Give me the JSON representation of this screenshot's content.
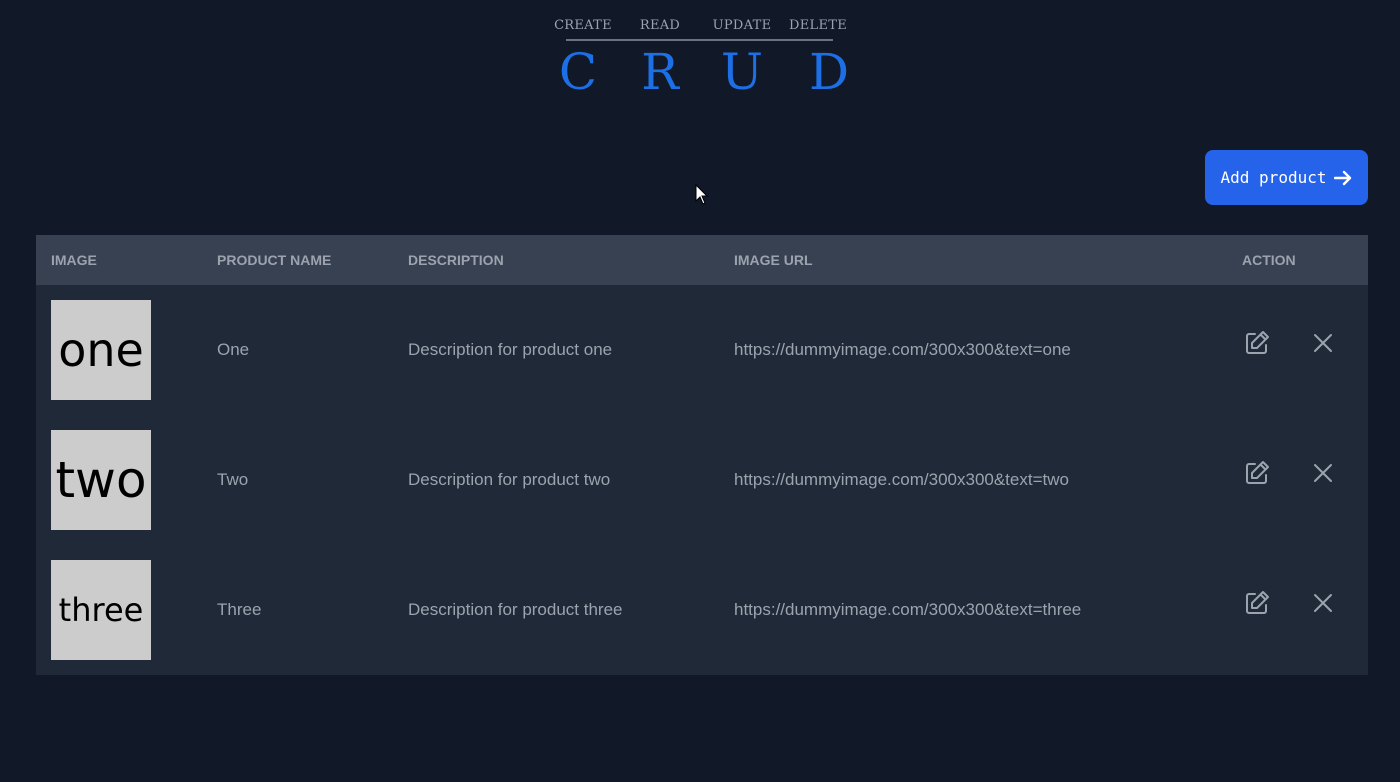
{
  "logo": {
    "words": [
      "CREATE",
      "READ",
      "UPDATE",
      "DELETE"
    ],
    "letters": [
      "C",
      "R",
      "U",
      "D"
    ]
  },
  "add_button": {
    "label": "Add product",
    "icon": "arrow-right-icon"
  },
  "table": {
    "headers": [
      "IMAGE",
      "PRODUCT NAME",
      "DESCRIPTION",
      "IMAGE URL",
      "ACTION"
    ],
    "rows": [
      {
        "image_text": "one",
        "name": "One",
        "description": "Description for product one",
        "url": "https://dummyimage.com/300x300&text=one"
      },
      {
        "image_text": "two",
        "name": "Two",
        "description": "Description for product two",
        "url": "https://dummyimage.com/300x300&text=two"
      },
      {
        "image_text": "three",
        "name": "Three",
        "description": "Description for product three",
        "url": "https://dummyimage.com/300x300&text=three"
      }
    ],
    "actions": [
      "edit-icon",
      "close-icon"
    ]
  },
  "colors": {
    "background": "#111827",
    "table_body": "#1f2937",
    "table_header": "#374151",
    "accent": "#2563eb",
    "logo_letters": "#1d6fe6",
    "thumbnail": "#cccccc"
  }
}
